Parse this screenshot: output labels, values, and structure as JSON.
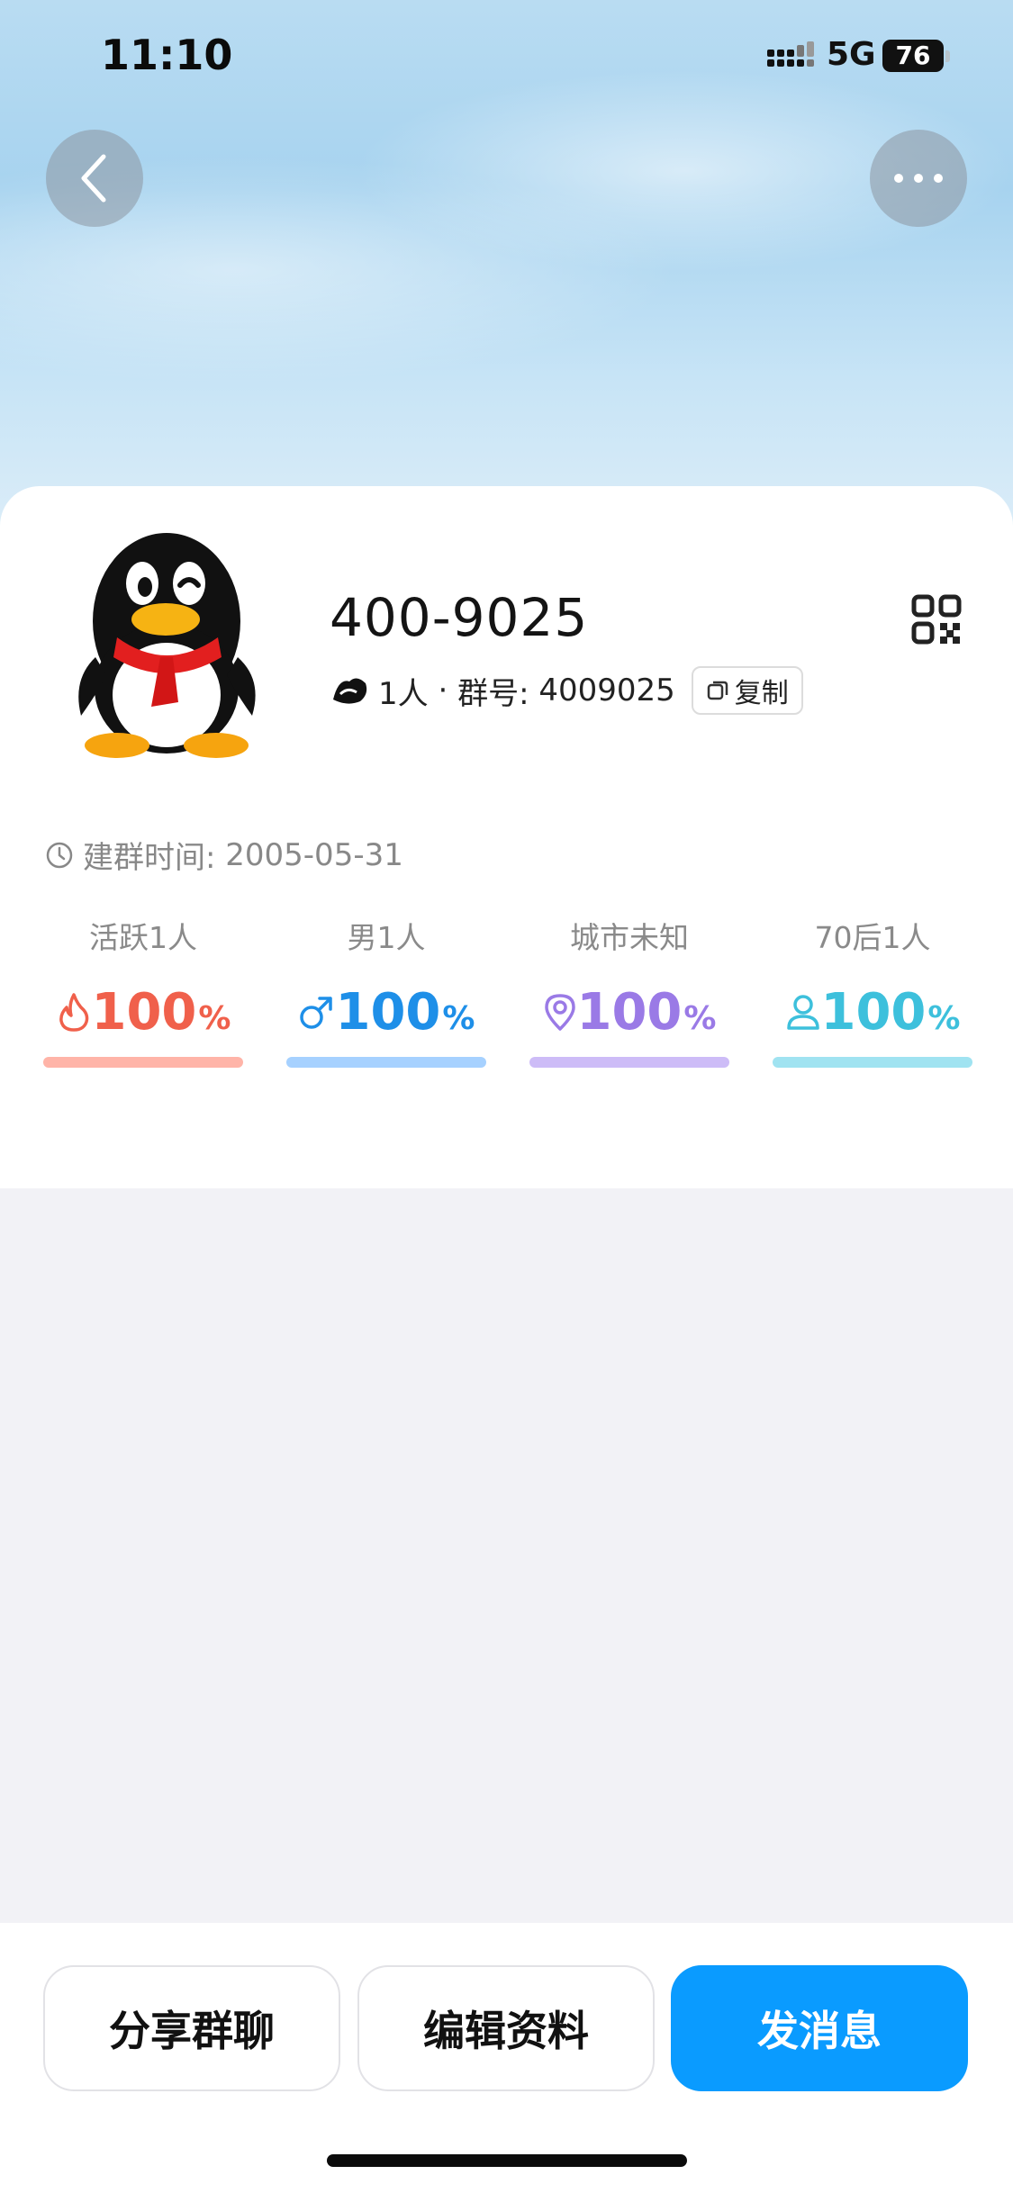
{
  "status_bar": {
    "time": "11:10",
    "network": "5G",
    "battery": "76"
  },
  "header": {
    "back_icon": "chevron-left-icon",
    "more_icon": "ellipsis-icon"
  },
  "group": {
    "name": "400-9025",
    "member_count": "1人",
    "separator": " · ",
    "group_number_label": "群号: ",
    "group_number": "4009025",
    "copy_label": "复制",
    "created_label": "建群时间: ",
    "created_date": "2005-05-31"
  },
  "stats": [
    {
      "label": "活跃",
      "sub": "1人",
      "value": "100",
      "unit": "%",
      "color": "#f0604b",
      "bar_color": "#ffb4a8",
      "icon": "flame-icon"
    },
    {
      "label": "男",
      "sub": "1人",
      "value": "100",
      "unit": "%",
      "color": "#1e8fe8",
      "bar_color": "#a6d1ff",
      "icon": "male-icon"
    },
    {
      "label": "城市",
      "sub": "未知",
      "value": "100",
      "unit": "%",
      "color": "#9a7ae6",
      "bar_color": "#cdbcf7",
      "icon": "location-pin-icon"
    },
    {
      "label": "70后",
      "sub": "1人",
      "value": "100",
      "unit": "%",
      "color": "#3dc0dc",
      "bar_color": "#a0e3f1",
      "icon": "person-icon"
    }
  ],
  "actions": {
    "share": "分享群聊",
    "edit": "编辑资料",
    "send": "发消息"
  },
  "colors": {
    "primary": "#0a9bff"
  }
}
